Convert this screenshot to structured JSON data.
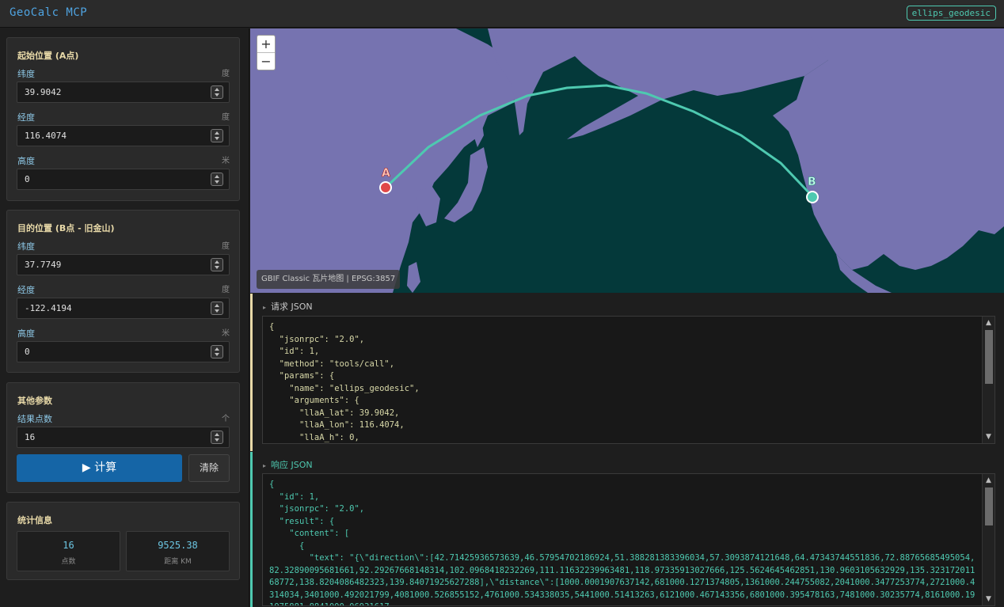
{
  "app": {
    "title": "GeoCalc MCP",
    "tool_badge": "ellips_geodesic"
  },
  "start": {
    "title": "起始位置 (A点)",
    "lat": {
      "label": "纬度",
      "unit": "度",
      "value": "39.9042"
    },
    "lon": {
      "label": "经度",
      "unit": "度",
      "value": "116.4074"
    },
    "h": {
      "label": "高度",
      "unit": "米",
      "value": "0"
    }
  },
  "dest": {
    "title": "目的位置 (B点 - 旧金山)",
    "lat": {
      "label": "纬度",
      "unit": "度",
      "value": "37.7749"
    },
    "lon": {
      "label": "经度",
      "unit": "度",
      "value": "-122.4194"
    },
    "h": {
      "label": "高度",
      "unit": "米",
      "value": "0"
    }
  },
  "other": {
    "title": "其他参数",
    "count": {
      "label": "结果点数",
      "unit": "个",
      "value": "16"
    },
    "calc_label": "▶ 计算",
    "clear_label": "清除"
  },
  "stats": {
    "title": "统计信息",
    "points": {
      "value": "16",
      "label": "点数"
    },
    "distance": {
      "value": "9525.38",
      "label": "距离 KM"
    }
  },
  "map": {
    "zoom_in": "+",
    "zoom_out": "−",
    "attribution": "GBIF Classic 瓦片地图 | EPSG:3857",
    "marker_a": "A",
    "marker_b": "B",
    "colors": {
      "ocean": "#04393a",
      "land": "#7673b0",
      "route": "#4ec9b0",
      "marker_a": "#e04848",
      "marker_b": "#4ec9b0"
    }
  },
  "request": {
    "header": "请求 JSON",
    "lines": [
      "{",
      "  \"jsonrpc\": \"2.0\",",
      "  \"id\": 1,",
      "  \"method\": \"tools/call\",",
      "  \"params\": {",
      "    \"name\": \"ellips_geodesic\",",
      "    \"arguments\": {",
      "      \"llaA_lat\": 39.9042,",
      "      \"llaA_lon\": 116.4074,",
      "      \"llaA_h\": 0,"
    ]
  },
  "response": {
    "header": "响应 JSON",
    "lines": [
      "{",
      "  \"id\": 1,",
      "  \"jsonrpc\": \"2.0\",",
      "  \"result\": {",
      "    \"content\": [",
      "      {",
      "        \"text\": \"{\\\"direction\\\":[42.71425936573639,46.57954702186924,51.388281383396034,57.3093874121648,64.47343744551836,72.88765685495054,82.32890095681661,92.29267668148314,102.0968418232269,111.11632239963481,118.97335913027666,125.5624645462851,130.9603105632929,135.32317201168772,138.8204086482323,139.84071925627288],\\\"distance\\\":[1000.0001907637142,681000.1271374805,1361000.244755082,2041000.3477253774,2721000.4314034,3401000.492021799,4081000.526855152,4761000.534338035,5441000.51413263,6121000.467143356,6801000.395478163,7481000.30235774,8161000.191975881,8841000.06931617"
    ]
  }
}
